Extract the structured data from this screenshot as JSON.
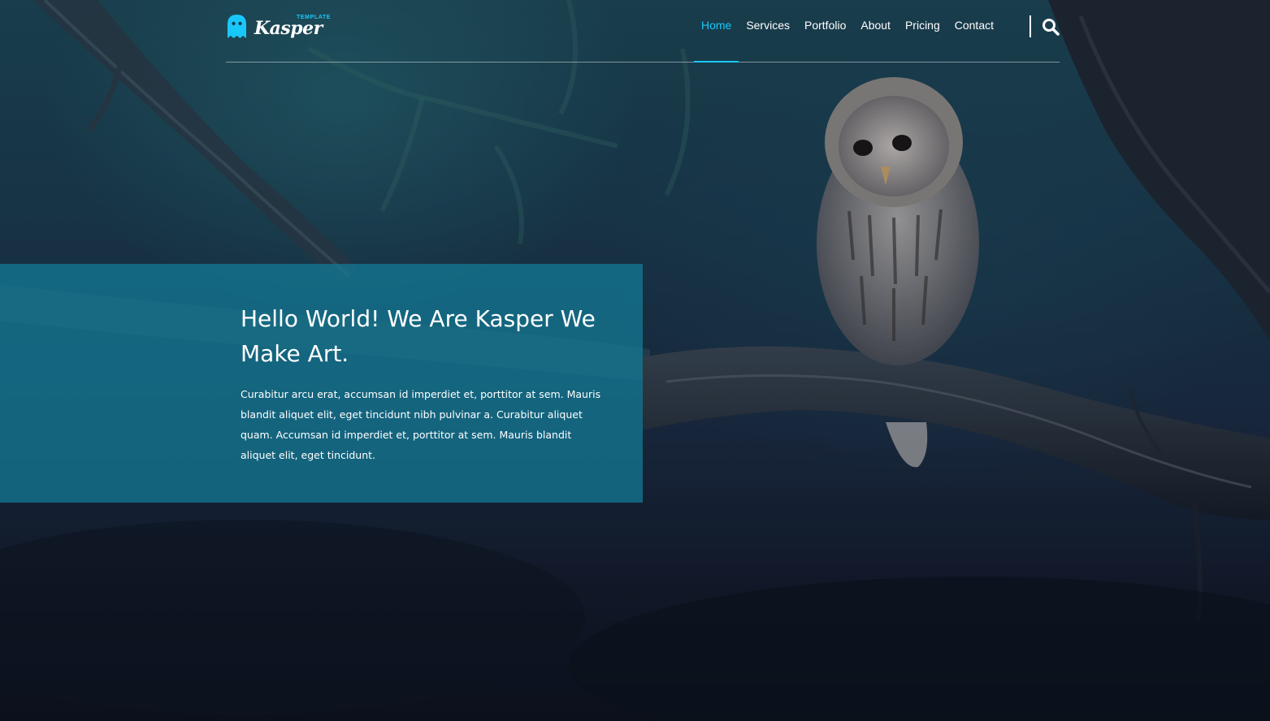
{
  "brand": {
    "name": "Kasper",
    "tagline": "TEMPLATE",
    "accent_color": "#19c8fa",
    "logo_icon": "ghost-icon"
  },
  "nav": {
    "items": [
      {
        "label": "Home",
        "active": true
      },
      {
        "label": "Services",
        "active": false
      },
      {
        "label": "Portfolio",
        "active": false
      },
      {
        "label": "About",
        "active": false
      },
      {
        "label": "Pricing",
        "active": false
      },
      {
        "label": "Contact",
        "active": false
      }
    ],
    "search_icon": "search-icon"
  },
  "hero": {
    "title": "Hello World! We Are Kasper We Make Art.",
    "text": "Curabitur arcu erat, accumsan id imperdiet et, porttitor at sem. Mauris blandit aliquet elit, eget tincidunt nibh pulvinar a. Curabitur aliquet quam. Accumsan id imperdiet et, porttitor at sem. Mauris blandit aliquet elit, eget tincidunt.",
    "panel_color": "#137d99",
    "background": "owl-on-branch-image"
  }
}
